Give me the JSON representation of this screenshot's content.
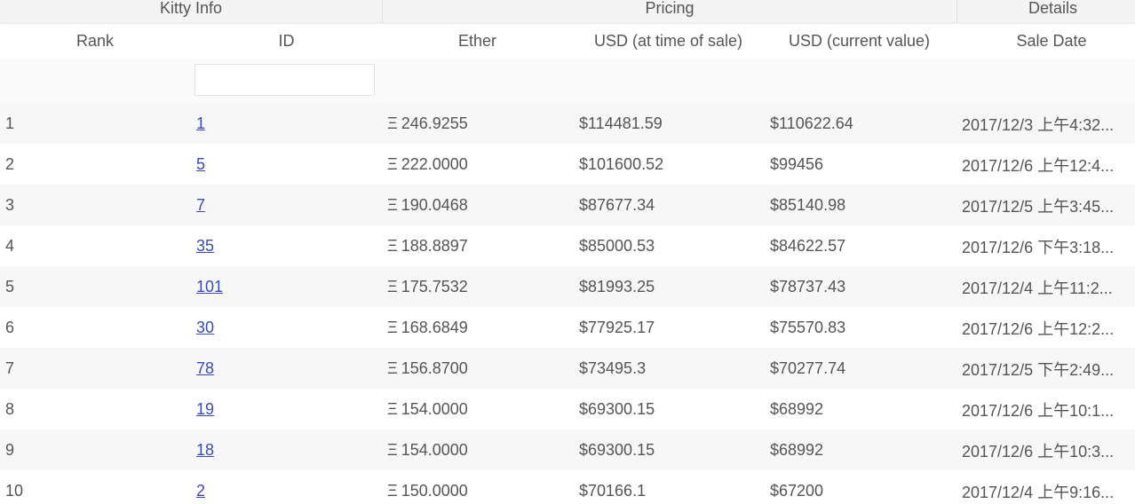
{
  "groups": {
    "kitty_info": "Kitty Info",
    "pricing": "Pricing",
    "details": "Details"
  },
  "columns": {
    "rank": "Rank",
    "id": "ID",
    "ether": "Ether",
    "usd_sale": "USD (at time of sale)",
    "usd_current": "USD (current value)",
    "sale_date": "Sale Date"
  },
  "filter": {
    "id_value": "",
    "id_placeholder": ""
  },
  "ether_symbol": "Ξ",
  "colors": {
    "link": "#3b4bb5",
    "stripe": "#f7f7f7",
    "header_bg": "#f4f4f4"
  },
  "rows": [
    {
      "rank": "1",
      "id": "1",
      "ether": "246.9255",
      "usd_sale": "$114481.59",
      "usd_current": "$110622.64",
      "sale_date": "2017/12/3 上午4:32..."
    },
    {
      "rank": "2",
      "id": "5",
      "ether": "222.0000",
      "usd_sale": "$101600.52",
      "usd_current": "$99456",
      "sale_date": "2017/12/6 上午12:4..."
    },
    {
      "rank": "3",
      "id": "7",
      "ether": "190.0468",
      "usd_sale": "$87677.34",
      "usd_current": "$85140.98",
      "sale_date": "2017/12/5 上午3:45..."
    },
    {
      "rank": "4",
      "id": "35",
      "ether": "188.8897",
      "usd_sale": "$85000.53",
      "usd_current": "$84622.57",
      "sale_date": "2017/12/6 下午3:18..."
    },
    {
      "rank": "5",
      "id": "101",
      "ether": "175.7532",
      "usd_sale": "$81993.25",
      "usd_current": "$78737.43",
      "sale_date": "2017/12/4 上午11:2..."
    },
    {
      "rank": "6",
      "id": "30",
      "ether": "168.6849",
      "usd_sale": "$77925.17",
      "usd_current": "$75570.83",
      "sale_date": "2017/12/6 上午12:2..."
    },
    {
      "rank": "7",
      "id": "78",
      "ether": "156.8700",
      "usd_sale": "$73495.3",
      "usd_current": "$70277.74",
      "sale_date": "2017/12/5 下午2:49..."
    },
    {
      "rank": "8",
      "id": "19",
      "ether": "154.0000",
      "usd_sale": "$69300.15",
      "usd_current": "$68992",
      "sale_date": "2017/12/6 上午10:1..."
    },
    {
      "rank": "9",
      "id": "18",
      "ether": "154.0000",
      "usd_sale": "$69300.15",
      "usd_current": "$68992",
      "sale_date": "2017/12/6 上午10:3..."
    },
    {
      "rank": "10",
      "id": "2",
      "ether": "150.0000",
      "usd_sale": "$70166.1",
      "usd_current": "$67200",
      "sale_date": "2017/12/4 上午9:16..."
    }
  ]
}
